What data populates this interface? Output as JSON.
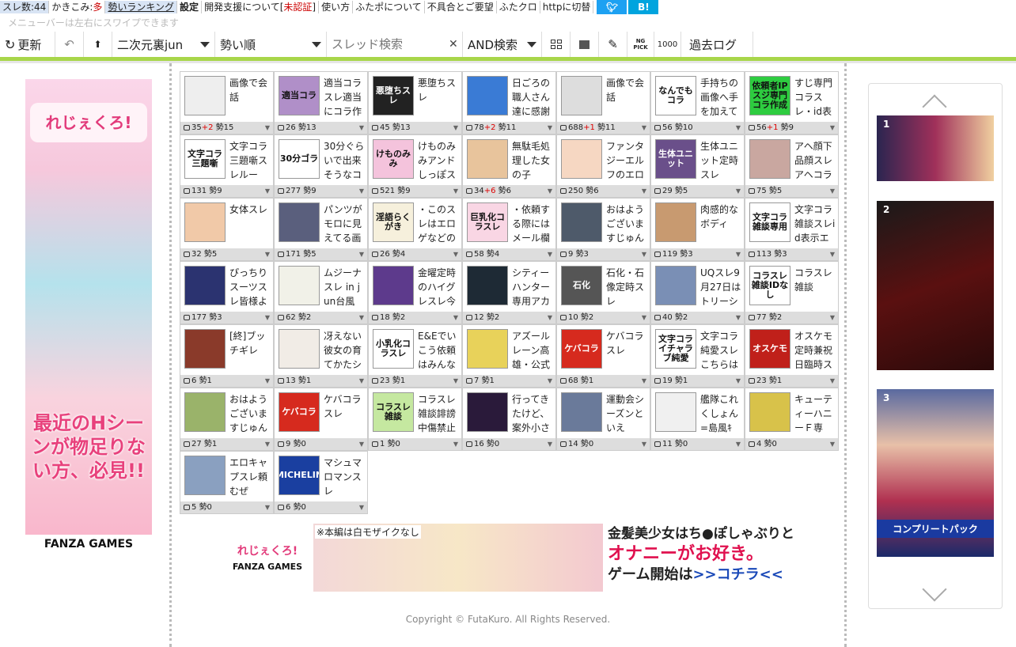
{
  "topmenu": {
    "items": [
      {
        "label": "スレ数:44",
        "style": "hl"
      },
      {
        "label": "かきこみ:",
        "extra": "多",
        "style": ""
      },
      {
        "label": "勢いランキング",
        "style": "hl u"
      },
      {
        "label": "設定",
        "style": "b"
      },
      {
        "label": "開発支援について[",
        "extra": "未認証",
        "suffix": "]",
        "style": ""
      },
      {
        "label": "使い方",
        "style": ""
      },
      {
        "label": "ふたポについて",
        "style": ""
      },
      {
        "label": "不具合とご要望",
        "style": ""
      },
      {
        "label": "ふたクロ",
        "style": ""
      },
      {
        "label": "httpに切替",
        "style": ""
      }
    ],
    "sns_twitter": "",
    "sns_hatena": "B!",
    "twitter_color": "#1da1f2",
    "hatena_color": "#00a4de"
  },
  "hint": "メニューバーは左右にスワイプできます",
  "toolbar": {
    "refresh": "更新",
    "board": "二次元裏jun",
    "sort": "勢い順",
    "search_placeholder": "スレッド検索",
    "search_mode": "AND検索",
    "ng_label": "NG PICK",
    "count_label": "1000",
    "past_log": "過去ログ"
  },
  "left_ad": {
    "logo": "れじぇくろ!",
    "copy": "最近のHシーンが物足りない方、必見!!",
    "brand": "FANZA GAMES"
  },
  "threads": [
    {
      "thumb": "",
      "title": "画像で会話",
      "res": "35",
      "plus": "+2",
      "ikioi": "勢15",
      "bg": "#eee"
    },
    {
      "thumb": "適当コラ",
      "title": "適当コラスレ適当にコラ作",
      "res": "26",
      "plus": "",
      "ikioi": "勢13",
      "bg": "#b08fc8"
    },
    {
      "thumb": "悪堕ちスレ",
      "title": "悪堕ちスレ",
      "res": "45",
      "plus": "",
      "ikioi": "勢13",
      "bg": "#222"
    },
    {
      "thumb": "",
      "title": "日ごろの職人さん達に感謝",
      "res": "78",
      "plus": "+2",
      "ikioi": "勢11",
      "bg": "#3a7bd5"
    },
    {
      "thumb": "",
      "title": "画像で会話",
      "res": "688",
      "plus": "+1",
      "ikioi": "勢11",
      "bg": "#ddd"
    },
    {
      "thumb": "なんでもコラ",
      "title": "手持ちの画像へ手を加えて",
      "res": "56",
      "plus": "",
      "ikioi": "勢10",
      "bg": "#fff"
    },
    {
      "thumb": "依頼者IPスジ専門コラ作成",
      "title": "すじ専門コラスレ・id表",
      "res": "56",
      "plus": "+1",
      "ikioi": "勢9",
      "bg": "#2ecc40"
    },
    {
      "thumb": "文字コラ三題噺",
      "title": "文字コラ三題噺スレルー",
      "res": "131",
      "plus": "",
      "ikioi": "勢9",
      "bg": "#fff"
    },
    {
      "thumb": "30分ゴラ",
      "title": "30分ぐらいで出来そうなコ",
      "res": "277",
      "plus": "",
      "ikioi": "勢9",
      "bg": "#fff"
    },
    {
      "thumb": "けものみみ",
      "title": "けものみみアンドしっぽス",
      "res": "521",
      "plus": "",
      "ikioi": "勢9",
      "bg": "#f4c3dc"
    },
    {
      "thumb": "",
      "title": "無駄毛処理した女の子",
      "res": "34",
      "plus": "+6",
      "ikioi": "勢6",
      "bg": "#e8c49c"
    },
    {
      "thumb": "",
      "title": "ファンタジーエルフのエロ",
      "res": "250",
      "plus": "",
      "ikioi": "勢6",
      "bg": "#f6d7c2"
    },
    {
      "thumb": "生体ユニット",
      "title": "生体ユニット定時スレ",
      "res": "29",
      "plus": "",
      "ikioi": "勢5",
      "bg": "#6a4f8a"
    },
    {
      "thumb": "",
      "title": "アヘ顔下品顔スレアヘコラ",
      "res": "75",
      "plus": "",
      "ikioi": "勢5",
      "bg": "#c9a7a0"
    },
    {
      "thumb": "",
      "title": "女体スレ",
      "res": "32",
      "plus": "",
      "ikioi": "勢5",
      "bg": "#f1c9a8"
    },
    {
      "thumb": "",
      "title": "パンツがモロに見えてる画",
      "res": "171",
      "plus": "",
      "ikioi": "勢5",
      "bg": "#5a5f7d"
    },
    {
      "thumb": "淫語らくがき",
      "title": "・このスレはエロゲなどの",
      "res": "26",
      "plus": "",
      "ikioi": "勢4",
      "bg": "#f6f0dc"
    },
    {
      "thumb": "巨乳化コラスレ",
      "title": "・依頼する際にはメール欄",
      "res": "58",
      "plus": "",
      "ikioi": "勢4",
      "bg": "#f9d6e4"
    },
    {
      "thumb": "",
      "title": "おはようございますじゅん",
      "res": "9",
      "plus": "",
      "ikioi": "勢3",
      "bg": "#4e5a6a"
    },
    {
      "thumb": "",
      "title": "肉感的なボディ",
      "res": "119",
      "plus": "",
      "ikioi": "勢3",
      "bg": "#c89a70"
    },
    {
      "thumb": "文字コラ雑談専用",
      "title": "文字コラ雑談スレid表示エ",
      "res": "113",
      "plus": "",
      "ikioi": "勢3",
      "bg": "#fff"
    },
    {
      "thumb": "",
      "title": "ぴっちりスーツスレ皆様よ",
      "res": "177",
      "plus": "",
      "ikioi": "勢3",
      "bg": "#2b3370"
    },
    {
      "thumb": "",
      "title": "ムジーナスレ in jun台風",
      "res": "62",
      "plus": "",
      "ikioi": "勢2",
      "bg": "#f1f1e8"
    },
    {
      "thumb": "",
      "title": "金曜定時のハイグレスレ今",
      "res": "18",
      "plus": "",
      "ikioi": "勢2",
      "bg": "#5d3a8c"
    },
    {
      "thumb": "",
      "title": "シティーハンター専用アカ",
      "res": "12",
      "plus": "",
      "ikioi": "勢2",
      "bg": "#1e2a35"
    },
    {
      "thumb": "石化",
      "title": "石化・石像定時スレ",
      "res": "10",
      "plus": "",
      "ikioi": "勢2",
      "bg": "#555"
    },
    {
      "thumb": "",
      "title": "UQスレ9月27日はトリーシ",
      "res": "40",
      "plus": "",
      "ikioi": "勢2",
      "bg": "#7a8fb5"
    },
    {
      "thumb": "コラスレ雑談IDなし",
      "title": "コラスレ雑談",
      "res": "77",
      "plus": "",
      "ikioi": "勢2",
      "bg": "#fff"
    },
    {
      "thumb": "",
      "title": "[終]ブッチギレ",
      "res": "6",
      "plus": "",
      "ikioi": "勢1",
      "bg": "#8a3a2a"
    },
    {
      "thumb": "",
      "title": "冴えない彼女の育てかたシ",
      "res": "13",
      "plus": "",
      "ikioi": "勢1",
      "bg": "#f1ece6"
    },
    {
      "thumb": "小乳化コラスレ",
      "title": "E&Eでいこう依頼はみんな",
      "res": "23",
      "plus": "",
      "ikioi": "勢1",
      "bg": "#fff"
    },
    {
      "thumb": "",
      "title": "アズールレーン高雄・公式",
      "res": "7",
      "plus": "",
      "ikioi": "勢1",
      "bg": "#e8d25a"
    },
    {
      "thumb": "ケバコラ",
      "title": "ケバコラスレ",
      "res": "68",
      "plus": "",
      "ikioi": "勢1",
      "bg": "#d62a1e"
    },
    {
      "thumb": "文字コライチャラブ純愛",
      "title": "文字コラ純愛スレこちらは",
      "res": "19",
      "plus": "",
      "ikioi": "勢1",
      "bg": "#fff"
    },
    {
      "thumb": "オスケモ",
      "title": "オスケモ定時兼祝日臨時ス",
      "res": "23",
      "plus": "",
      "ikioi": "勢1",
      "bg": "#c0201a"
    },
    {
      "thumb": "",
      "title": "おはようございますじゅん",
      "res": "27",
      "plus": "",
      "ikioi": "勢1",
      "bg": "#9ab36a"
    },
    {
      "thumb": "ケバコラ",
      "title": "ケバコラスレ",
      "res": "9",
      "plus": "",
      "ikioi": "勢0",
      "bg": "#d62a1e"
    },
    {
      "thumb": "コラスレ雑談",
      "title": "コラスレ雑談誹謗中傷禁止",
      "res": "1",
      "plus": "",
      "ikioi": "勢0",
      "bg": "#c5e8a0"
    },
    {
      "thumb": "",
      "title": "行ってきたけど、案外小さ",
      "res": "16",
      "plus": "",
      "ikioi": "勢0",
      "bg": "#2a1a3a"
    },
    {
      "thumb": "",
      "title": "運動会シーズンといえ",
      "res": "14",
      "plus": "",
      "ikioi": "勢0",
      "bg": "#6a7a9a"
    },
    {
      "thumb": "",
      "title": "艦隊これくしょん=島風ｷ",
      "res": "11",
      "plus": "",
      "ikioi": "勢0",
      "bg": "#f0f0f0"
    },
    {
      "thumb": "",
      "title": "キューティーハニーＦ専",
      "res": "4",
      "plus": "",
      "ikioi": "勢0",
      "bg": "#d8c24a"
    },
    {
      "thumb": "",
      "title": "エロキャプスレ頼むぜ",
      "res": "5",
      "plus": "",
      "ikioi": "勢0",
      "bg": "#8aa0c0"
    },
    {
      "thumb": "MICHELIN",
      "title": "マシュマロマンスレ",
      "res": "6",
      "plus": "",
      "ikioi": "勢0",
      "bg": "#1a3fa0"
    }
  ],
  "banner": {
    "logo": "れじぇくろ!",
    "logo_brand": "FANZA GAMES",
    "note": "※本編は白モザイクなし",
    "line1": "金髪美少女はち●ぽしゃぶりと",
    "line2": "オナニーがお好き。",
    "line3_a": "ゲーム開始は",
    "line3_b": ">>コチラ<<"
  },
  "copyright": "Copyright © FutaKuro. All Rights Reserved.",
  "carousel": [
    {
      "num": "1",
      "cap": ""
    },
    {
      "num": "2",
      "cap": ""
    },
    {
      "num": "3",
      "cap": "コンプリートパック"
    }
  ]
}
